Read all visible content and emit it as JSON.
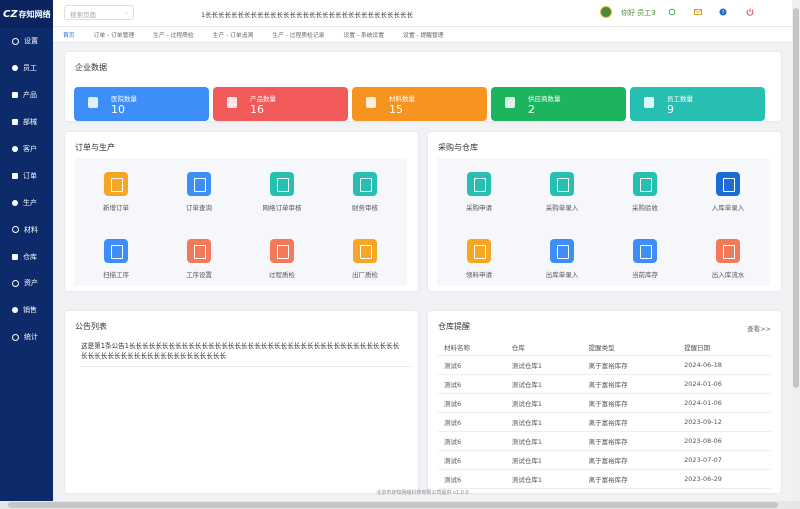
{
  "app": {
    "logo_mark": "CZ",
    "logo_text": "存知网络"
  },
  "sidebar": {
    "items": [
      {
        "label": "设置",
        "icon": "gear-icon"
      },
      {
        "label": "员工",
        "icon": "user-icon"
      },
      {
        "label": "产品",
        "icon": "product-icon"
      },
      {
        "label": "部械",
        "icon": "device-icon"
      },
      {
        "label": "客户",
        "icon": "customer-icon"
      },
      {
        "label": "订单",
        "icon": "order-icon"
      },
      {
        "label": "生产",
        "icon": "production-icon"
      },
      {
        "label": "材料",
        "icon": "material-icon"
      },
      {
        "label": "仓库",
        "icon": "warehouse-icon"
      },
      {
        "label": "资产",
        "icon": "asset-icon"
      },
      {
        "label": "销售",
        "icon": "sales-icon"
      },
      {
        "label": "统计",
        "icon": "stats-icon"
      }
    ]
  },
  "topbar": {
    "search_placeholder": "搜索页面",
    "marquee": "1长长长长长长长长长长长长长长长长长长长长长长长长长长长长长长长长",
    "greeting": "你好 员工3"
  },
  "tabs": [
    {
      "label": "首页",
      "active": true
    },
    {
      "label": "订单 - 订单管理"
    },
    {
      "label": "生产 - 过程质检"
    },
    {
      "label": "生产 - 订单追溯"
    },
    {
      "label": "生产 - 过程质检记录"
    },
    {
      "label": "设置 - 系统设置"
    },
    {
      "label": "设置 - 提醒管理"
    }
  ],
  "enterprise": {
    "title": "企业数据",
    "stats": [
      {
        "label": "医院数量",
        "value": "10",
        "color": "#3d8ef7"
      },
      {
        "label": "产品数量",
        "value": "16",
        "color": "#f25a5a"
      },
      {
        "label": "材料数量",
        "value": "15",
        "color": "#f79420"
      },
      {
        "label": "供应商数量",
        "value": "2",
        "color": "#1db45e"
      },
      {
        "label": "员工数量",
        "value": "9",
        "color": "#27bfb2"
      }
    ]
  },
  "orders": {
    "title": "订单与生产",
    "items": [
      {
        "label": "新增订单",
        "color": "#f5a623"
      },
      {
        "label": "订单查询",
        "color": "#3d8ef7"
      },
      {
        "label": "网络订单审核",
        "color": "#27bfb2"
      },
      {
        "label": "财务审核",
        "color": "#27bfb2"
      },
      {
        "label": "扫描工序",
        "color": "#3d8ef7"
      },
      {
        "label": "工序设置",
        "color": "#f27a5a"
      },
      {
        "label": "过程质检",
        "color": "#f27a5a"
      },
      {
        "label": "出厂质检",
        "color": "#f5a623"
      }
    ]
  },
  "purchase": {
    "title": "采购与仓库",
    "items": [
      {
        "label": "采购申请",
        "color": "#27bfb2"
      },
      {
        "label": "采购单录入",
        "color": "#27bfb2"
      },
      {
        "label": "采购验收",
        "color": "#27bfb2"
      },
      {
        "label": "入库单录入",
        "color": "#1e6bd6"
      },
      {
        "label": "领料申请",
        "color": "#f5a623"
      },
      {
        "label": "出库单录入",
        "color": "#3d8ef7"
      },
      {
        "label": "当前库存",
        "color": "#3d8ef7"
      },
      {
        "label": "出入库流水",
        "color": "#f27a5a"
      }
    ]
  },
  "notices": {
    "title": "公告列表",
    "text": "这是第1条公告1长长长长长长长长长长长长长长长长长长长长长长长长长长长长长长长长长长长长长长长长长长长长长长长长长长长长长长长长长长长长长长长"
  },
  "warehouse_alerts": {
    "title": "仓库提醒",
    "more": "查看>>",
    "columns": [
      "材料名称",
      "仓库",
      "提醒类型",
      "提醒日期"
    ],
    "rows": [
      [
        "测试6",
        "测试仓库1",
        "离于富裕库存",
        "2024-06-18"
      ],
      [
        "测试6",
        "测试仓库1",
        "离于富裕库存",
        "2024-01-06"
      ],
      [
        "测试6",
        "测试仓库1",
        "离于富裕库存",
        "2024-01-06"
      ],
      [
        "测试6",
        "测试仓库1",
        "离于富裕库存",
        "2023-09-12"
      ],
      [
        "测试6",
        "测试仓库1",
        "离于富裕库存",
        "2023-08-06"
      ],
      [
        "测试6",
        "测试仓库1",
        "离于富裕库存",
        "2023-07-07"
      ],
      [
        "测试6",
        "测试仓库1",
        "离于富裕库存",
        "2023-06-29"
      ]
    ]
  },
  "footer": {
    "text": "北京市存知网络科技有限公司提供 v1.0.0"
  }
}
